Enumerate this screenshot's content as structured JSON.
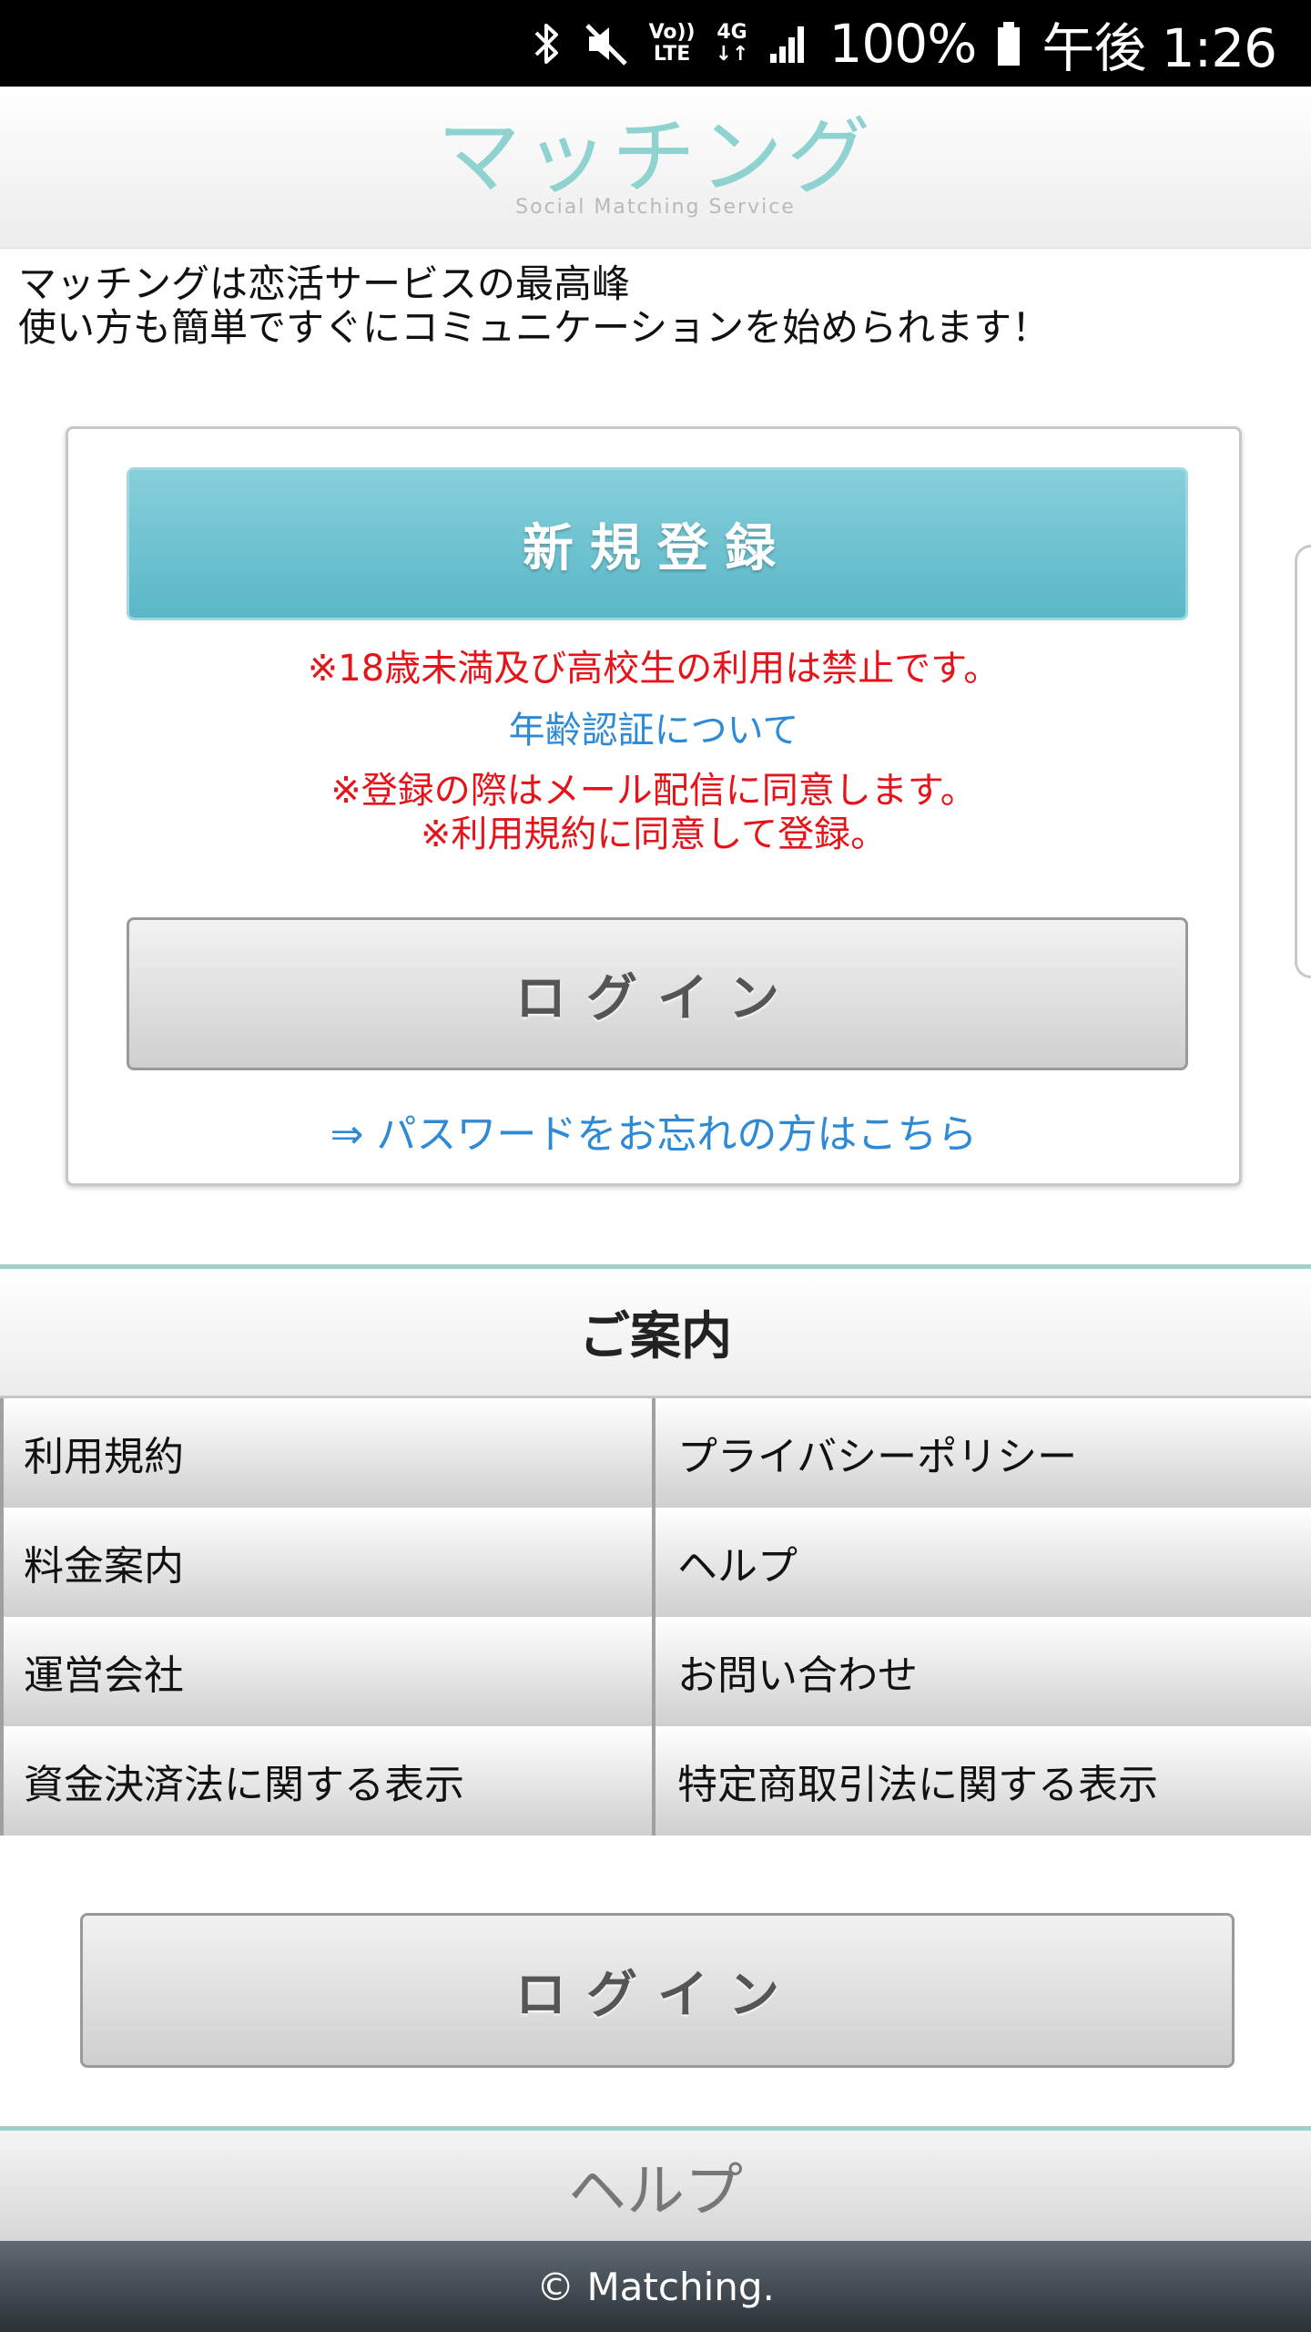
{
  "status_bar": {
    "network_top": "Vo))",
    "network_bottom": "LTE",
    "signal_type": "4G",
    "battery_percent": "100%",
    "time": "午後 1:26",
    "icons": [
      "bluetooth-icon",
      "mute-icon",
      "volte-icon",
      "4g-icon",
      "signal-icon",
      "battery-icon"
    ]
  },
  "header": {
    "logo_text": "マッチング",
    "logo_subtitle": "Social Matching Service"
  },
  "intro": {
    "line1": "マッチングは恋活サービスの最高峰",
    "line2": "使い方も簡単ですぐにコミュニケーションを始められます！"
  },
  "card": {
    "register_label": "新規登録",
    "notice_age": "※18歳未満及び高校生の利用は禁止です。",
    "age_verification_link": "年齢認証について",
    "notice_mail": "※登録の際はメール配信に同意します。",
    "notice_terms": "※利用規約に同意して登録。",
    "login_label": "ログイン",
    "forgot_password_link": "⇒ パスワードをお忘れの方はこちら"
  },
  "guide": {
    "title": "ご案内",
    "items": [
      {
        "label": "利用規約"
      },
      {
        "label": "プライバシーポリシー"
      },
      {
        "label": "料金案内"
      },
      {
        "label": "ヘルプ"
      },
      {
        "label": "運営会社"
      },
      {
        "label": "お問い合わせ"
      },
      {
        "label": "資金決済法に関する表示"
      },
      {
        "label": "特定商取引法に関する表示"
      }
    ]
  },
  "bottom": {
    "login_label": "ログイン",
    "help_label": "ヘルプ",
    "copyright": "© Matching."
  },
  "colors": {
    "accent_teal": "#5ab7c7",
    "warning_red": "#e4141a",
    "link_blue": "#2f8ad6",
    "logo_teal": "#8fd3d0"
  }
}
